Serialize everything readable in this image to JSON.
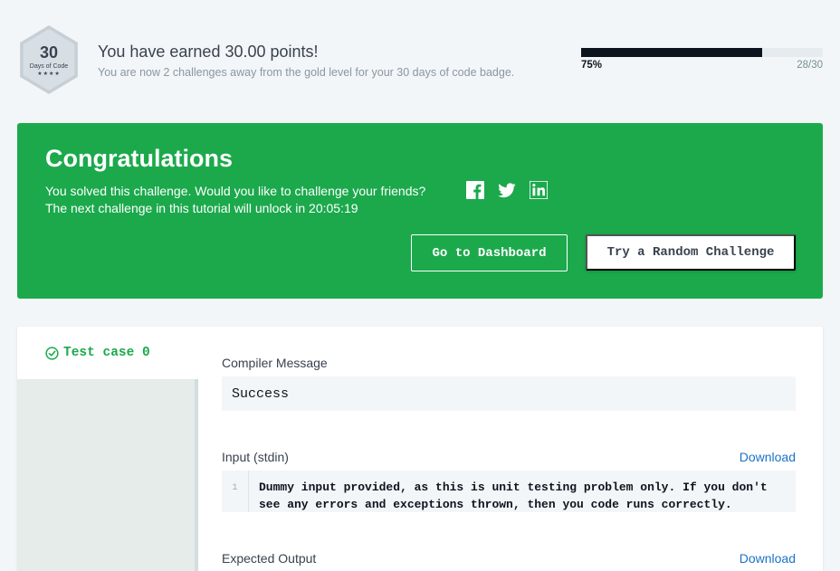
{
  "badge": {
    "number": "30",
    "label": "Days of Code",
    "stars": "★★★★"
  },
  "earned": {
    "title": "You have earned 30.00 points!",
    "subtitle": "You are now 2 challenges away from the gold level for your 30 days of code badge."
  },
  "progress": {
    "fraction": 0.75,
    "percent_label": "75%",
    "count_label": "28/30"
  },
  "congrats": {
    "title": "Congratulations",
    "line1": "You solved this challenge. Would you like to challenge your friends?",
    "line2": "The next challenge in this tutorial will unlock in 20:05:19",
    "share_icons": [
      "facebook-icon",
      "twitter-icon",
      "linkedin-icon"
    ],
    "dashboard_button": "Go to Dashboard",
    "random_button": "Try a Random Challenge"
  },
  "results": {
    "tab_label": "Test case 0",
    "compiler_label": "Compiler Message",
    "compiler_message": "Success",
    "input_label": "Input (stdin)",
    "input_download": "Download",
    "input_line_number": "1",
    "input_text": "Dummy input provided, as this is unit testing problem only. If you don't\nsee any errors and exceptions thrown, then you code runs correctly.",
    "expected_label": "Expected Output",
    "expected_download": "Download"
  },
  "colors": {
    "accent_green": "#1ba94c",
    "link_blue": "#1a73c8",
    "progress_dark": "#0e141e"
  }
}
